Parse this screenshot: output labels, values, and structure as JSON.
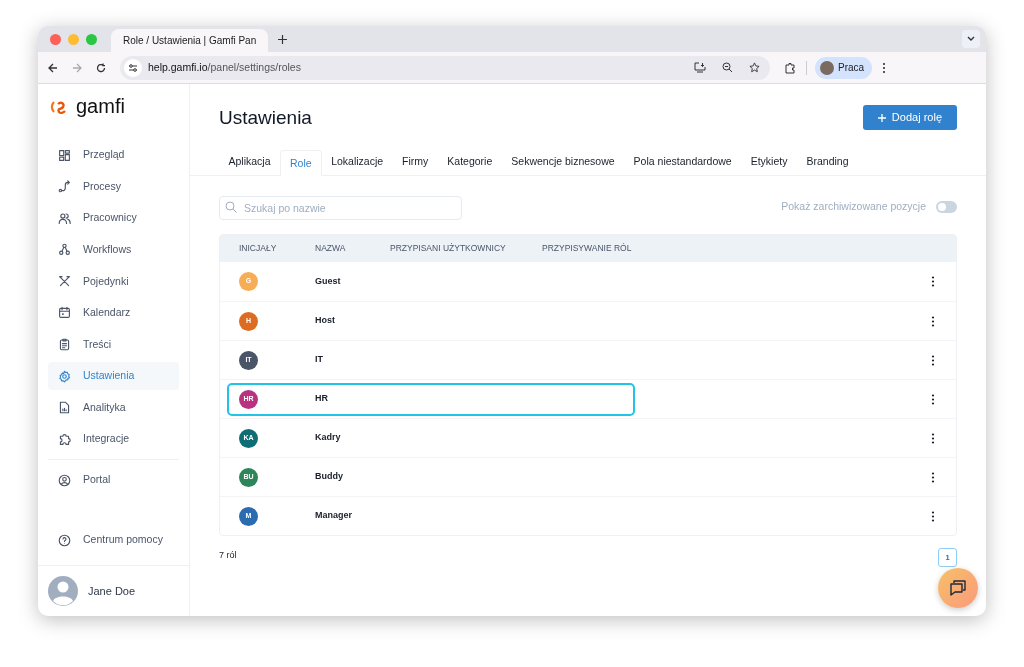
{
  "browser": {
    "tab_title": "Role / Ustawienia | Gamfi Pan",
    "url_host": "help.gamfi.io",
    "url_path": "/panel/settings/roles",
    "profile": "Praca"
  },
  "sidebar": {
    "logo": "gamfi",
    "items": [
      {
        "label": "Przegląd",
        "selected": false
      },
      {
        "label": "Procesy",
        "selected": false
      },
      {
        "label": "Pracownicy",
        "selected": false
      },
      {
        "label": "Workflows",
        "selected": false
      },
      {
        "label": "Pojedynki",
        "selected": false
      },
      {
        "label": "Kalendarz",
        "selected": false
      },
      {
        "label": "Treści",
        "selected": false
      },
      {
        "label": "Ustawienia",
        "selected": true
      },
      {
        "label": "Analityka",
        "selected": false
      },
      {
        "label": "Integracje",
        "selected": false
      }
    ],
    "portal": "Portal",
    "help": "Centrum pomocy",
    "user": "Jane Doe"
  },
  "page": {
    "title": "Ustawienia",
    "add_button": "Dodaj rolę"
  },
  "tabs": [
    {
      "label": "Aplikacja",
      "selected": false
    },
    {
      "label": "Role",
      "selected": true
    },
    {
      "label": "Lokalizacje",
      "selected": false
    },
    {
      "label": "Firmy",
      "selected": false
    },
    {
      "label": "Kategorie",
      "selected": false
    },
    {
      "label": "Sekwencje biznesowe",
      "selected": false
    },
    {
      "label": "Pola niestandardowe",
      "selected": false
    },
    {
      "label": "Etykiety",
      "selected": false
    },
    {
      "label": "Branding",
      "selected": false
    }
  ],
  "search": {
    "placeholder": "Szukaj po nazwie"
  },
  "archived_toggle": {
    "label": "Pokaż zarchiwizowane pozycje",
    "on": false
  },
  "table": {
    "columns": [
      "INICJAŁY",
      "NAZWA",
      "PRZYPISANI UŻYTKOWNICY",
      "PRZYPISYWANIE RÓL"
    ],
    "rows": [
      {
        "initials": "G",
        "name": "Guest",
        "color": "#f6ad55",
        "selected": false
      },
      {
        "initials": "H",
        "name": "Host",
        "color": "#dd6b20",
        "selected": false
      },
      {
        "initials": "IT",
        "name": "IT",
        "color": "#4a5568",
        "selected": false
      },
      {
        "initials": "HR",
        "name": "HR",
        "color": "#b83280",
        "selected": true
      },
      {
        "initials": "KA",
        "name": "Kadry",
        "color": "#0f6e75",
        "selected": false
      },
      {
        "initials": "BU",
        "name": "Buddy",
        "color": "#2f855a",
        "selected": false
      },
      {
        "initials": "M",
        "name": "Manager",
        "color": "#2b6cb0",
        "selected": false
      }
    ]
  },
  "footer": {
    "count": "7 ról",
    "pages": [
      {
        "label": "1",
        "selected": true
      }
    ]
  }
}
